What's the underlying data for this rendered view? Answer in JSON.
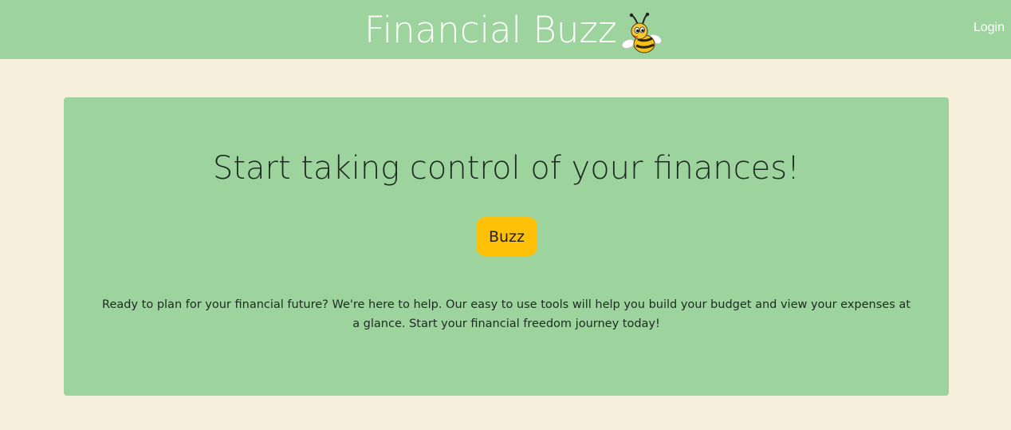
{
  "navbar": {
    "brand": "Financial Buzz",
    "logo_icon": "bee-icon",
    "login_label": "Login",
    "background": "#9dd39d"
  },
  "hero": {
    "title": "Start taking control of your finances!",
    "button_label": "Buzz",
    "button_color": "#ffc107",
    "description": "Ready to plan for your financial future? We're here to help. Our easy to use tools will help you build your budget and view your expenses at a glance. Start your financial freedom journey today!",
    "background": "#9dd39d"
  },
  "page": {
    "background": "#f5efdc"
  }
}
